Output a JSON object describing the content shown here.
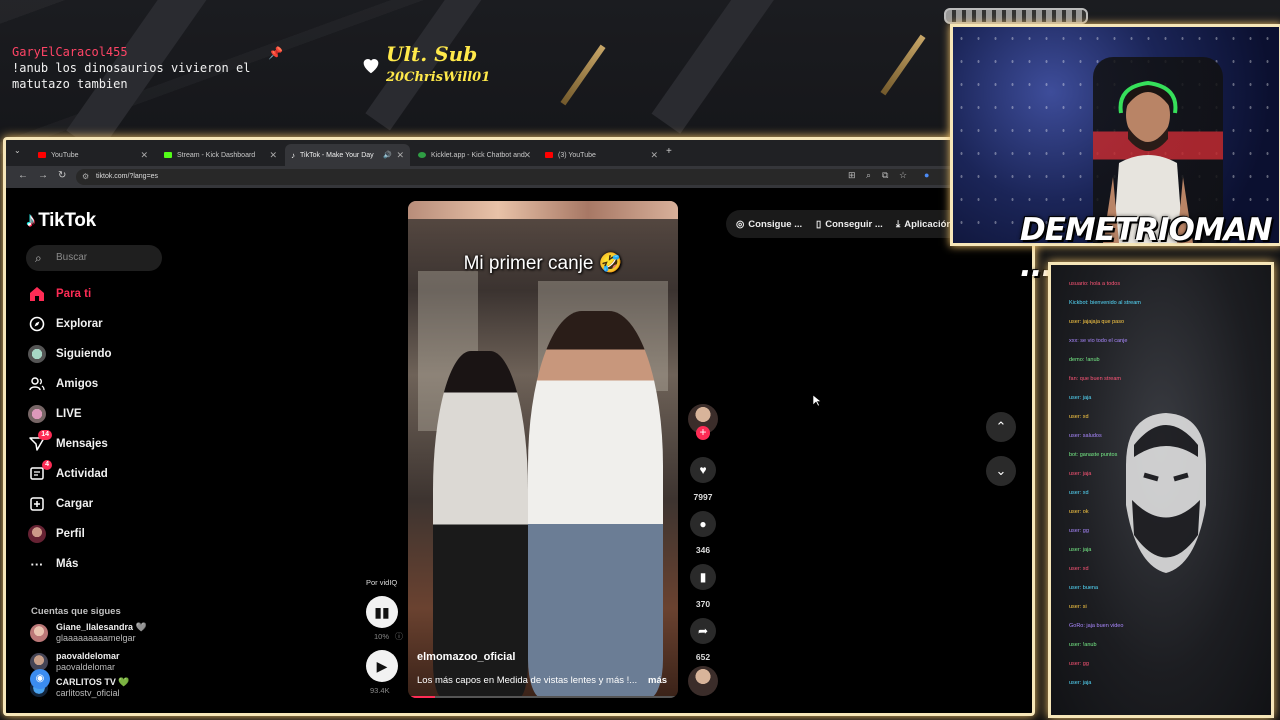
{
  "stream": {
    "chat_user": "GaryElCaracol455",
    "chat_message": "!anub los dinosaurios vivieron el matutazo tambien",
    "sub_title": "Ult. Sub",
    "sub_name": "20ChrisWill01",
    "streamer_name": "DEMETRIOMAN ....",
    "accent": "#f6e6b8"
  },
  "browser": {
    "tabs": [
      {
        "label": "YouTube",
        "favicon": "#ff0000",
        "active": false
      },
      {
        "label": "Stream - Kick Dashboard",
        "favicon": "#53fc18",
        "active": false
      },
      {
        "label": "TikTok - Make Your Day",
        "favicon": "#ffffff",
        "active": true
      },
      {
        "label": "Kicklet.app - Kick Chatbot and",
        "favicon": "#2f9e44",
        "active": false
      },
      {
        "label": "(3) YouTube",
        "favicon": "#ff0000",
        "active": false
      }
    ],
    "url": "tiktok.com/?lang=es"
  },
  "tiktok": {
    "logo": "TikTok",
    "search_placeholder": "Buscar",
    "nav": [
      {
        "label": "Para ti",
        "icon": "home-icon",
        "active": true
      },
      {
        "label": "Explorar",
        "icon": "compass-icon"
      },
      {
        "label": "Siguiendo",
        "icon": "following-icon"
      },
      {
        "label": "Amigos",
        "icon": "friends-icon"
      },
      {
        "label": "LIVE",
        "icon": "live-icon"
      },
      {
        "label": "Mensajes",
        "icon": "messages-icon",
        "badge": "14"
      },
      {
        "label": "Actividad",
        "icon": "activity-icon",
        "badge": "4"
      },
      {
        "label": "Cargar",
        "icon": "upload-icon"
      },
      {
        "label": "Perfil",
        "icon": "profile-icon"
      },
      {
        "label": "Más",
        "icon": "more-icon"
      }
    ],
    "following_heading": "Cuentas que sigues",
    "following": [
      {
        "name": "Giane_llalesandra 🩶",
        "handle": "glaaaaaaaaamelgar"
      },
      {
        "name": "paovaldelomar",
        "handle": "paovaldelomar"
      },
      {
        "name": "CARLITOS TV 💚",
        "handle": "carlitostv_oficial"
      }
    ],
    "top_actions": [
      "Consigue ...",
      "Conseguir ...",
      "Aplicación"
    ],
    "video": {
      "caption": "Mi primer canje 🤣",
      "username": "elmomazoo_oficial",
      "description": "Los más capos en Medida de vistas lentes y más !...",
      "more": "más",
      "progress": 0.1
    },
    "counts": {
      "likes": "7997",
      "comments": "346",
      "saves": "370",
      "shares": "652"
    },
    "vidiq": {
      "label": "Por vidIQ",
      "percent": "10%",
      "views": "93.4K"
    }
  },
  "chat_panel": {
    "lines": [
      "usuario: hola a todos",
      "Kickbot: bienvenido al stream",
      "user: jajajaja que paso",
      "xxx: se vio todo el canje",
      "demo: !anub",
      "fan: que buen stream",
      "user: jaja",
      "user: xd",
      "user: saludos",
      "bot: ganaste puntos",
      "user: jaja",
      "user: xd",
      "user: ok",
      "user: gg",
      "user: jaja",
      "user: xd",
      "user: buena",
      "user: si",
      "GoRo: jaja buen video",
      "user: !anub",
      "user: gg",
      "user: jaja"
    ]
  }
}
